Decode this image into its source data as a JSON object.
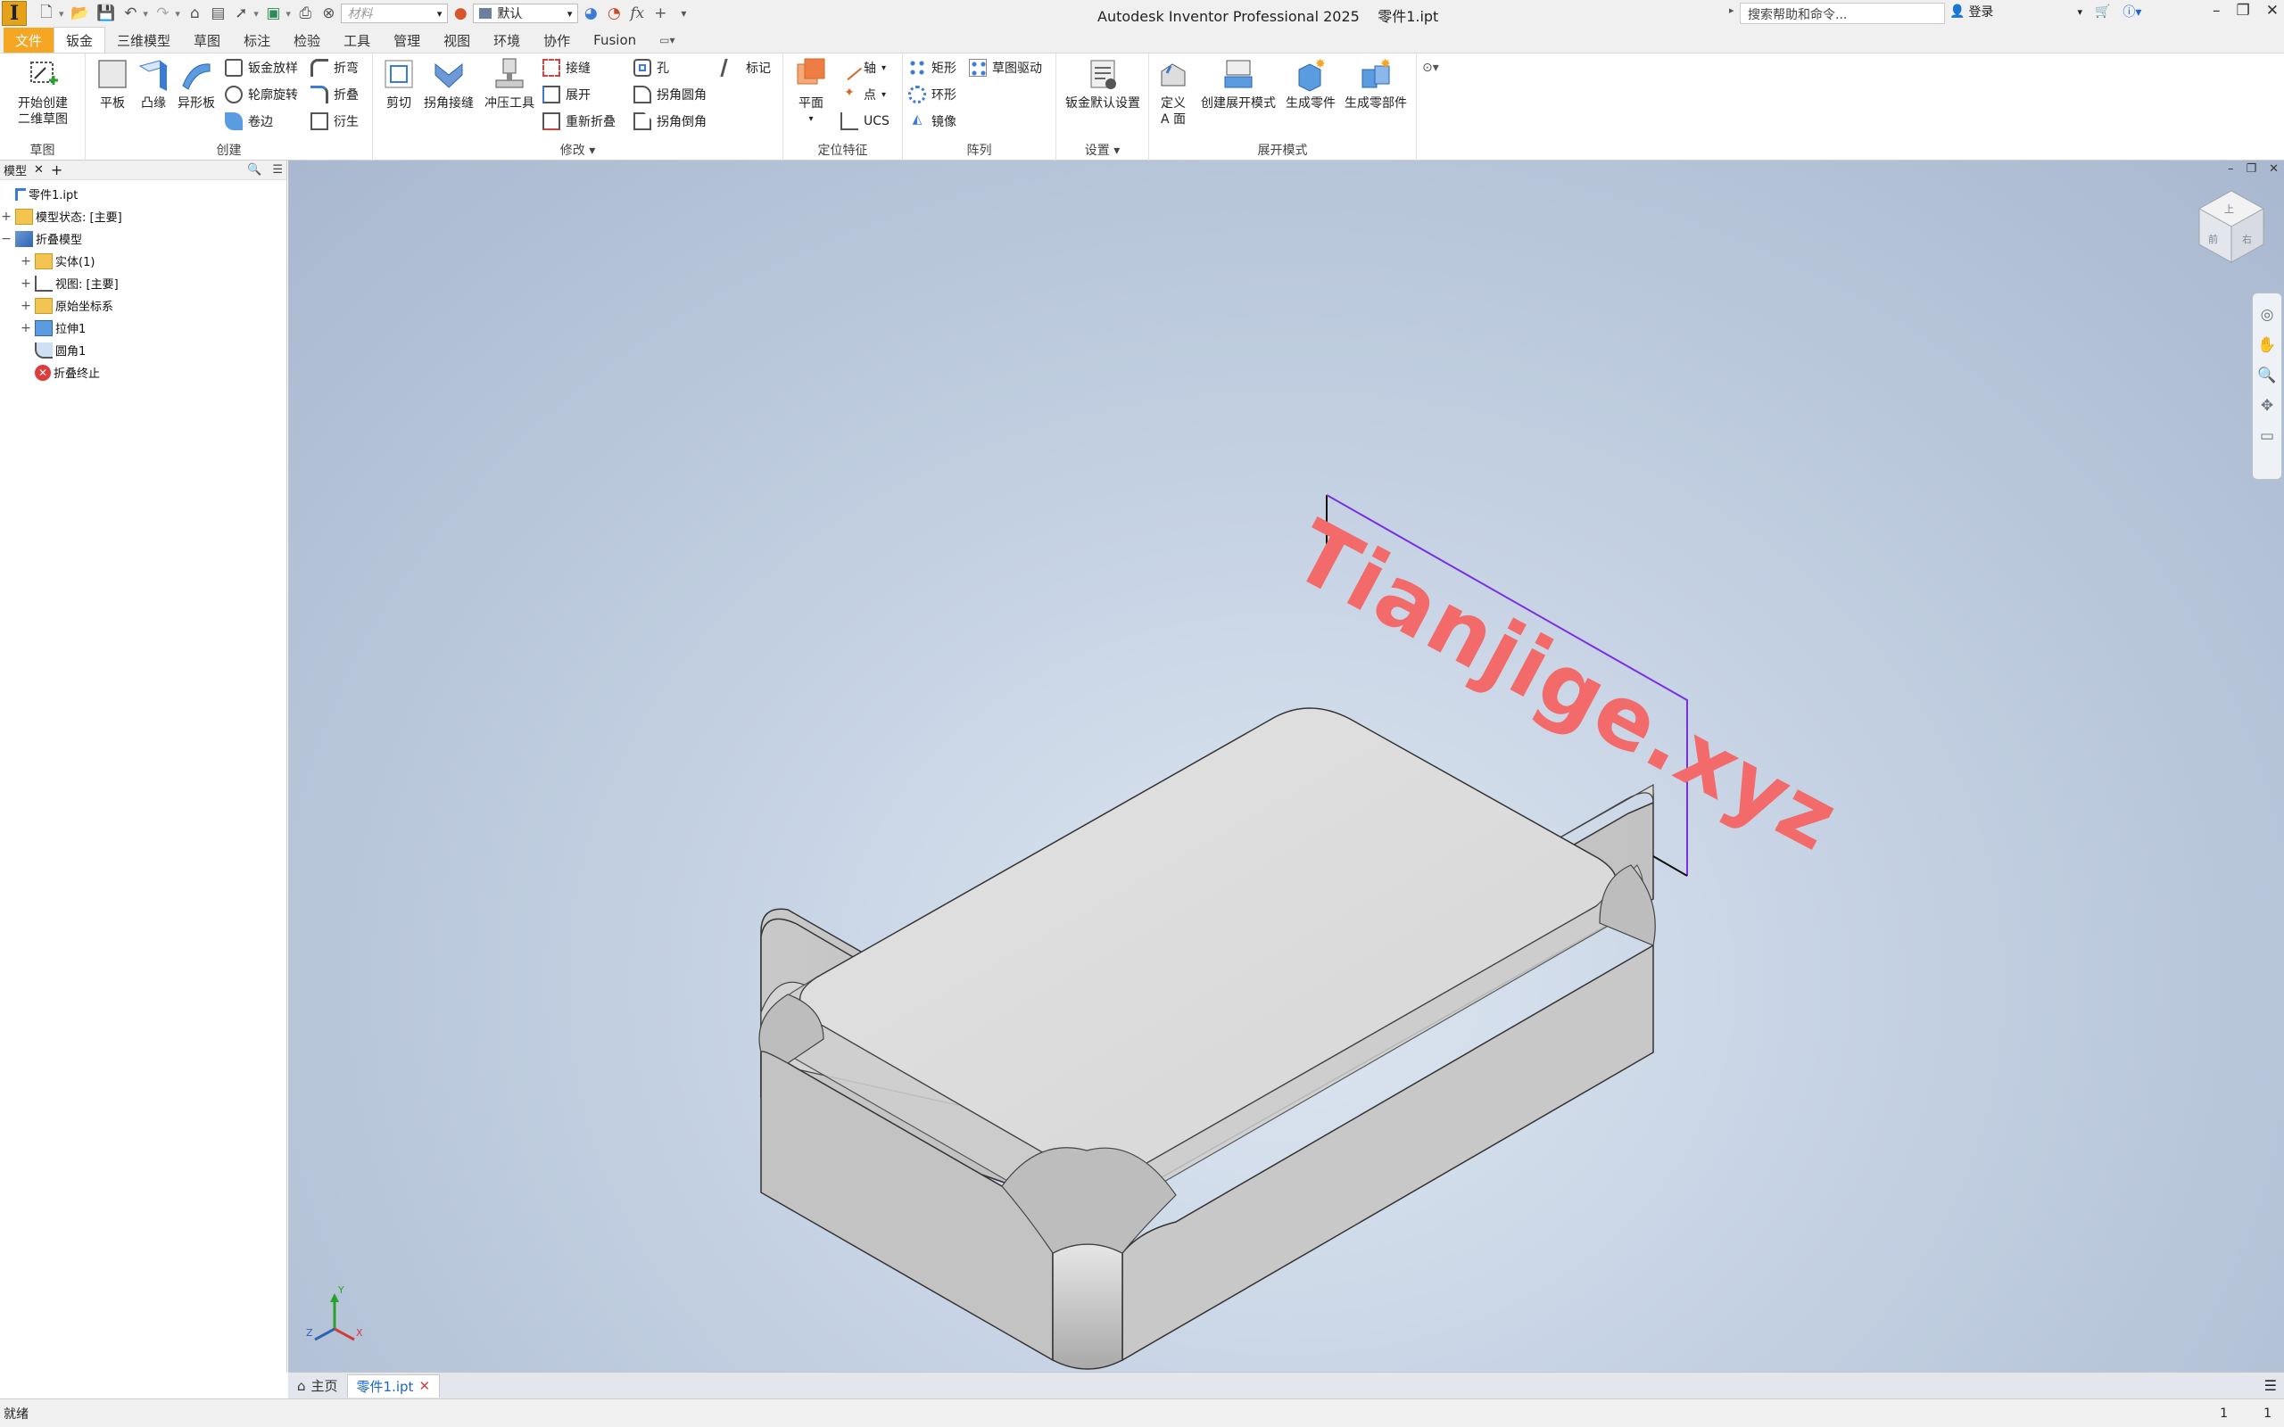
{
  "app": {
    "title": "Autodesk Inventor Professional 2025",
    "document": "零件1.ipt",
    "logo_letter": "I"
  },
  "quick_access": {
    "material_placeholder": "材料",
    "appearance_value": "默认",
    "fx_label": "fx"
  },
  "help": {
    "search_placeholder": "搜索帮助和命令...",
    "login": "登录"
  },
  "menu_tabs": [
    "文件",
    "钣金",
    "三维模型",
    "草图",
    "标注",
    "检验",
    "工具",
    "管理",
    "视图",
    "环境",
    "协作",
    "Fusion"
  ],
  "ribbon": {
    "sketch_panel": {
      "label": "草图",
      "start_sketch": "开始创建\n二维草图"
    },
    "create_panel": {
      "label": "创建",
      "face": "平板",
      "contour_flange": "凸缘",
      "lofted_flange": "异形板",
      "sm_loft": "钣金放样",
      "contour_roll": "轮廓旋转",
      "hem": "卷边",
      "bend": "折弯",
      "fold": "折叠",
      "derive": "衍生"
    },
    "modify_panel": {
      "label": "修改",
      "cut": "剪切",
      "corner_seam": "拐角接缝",
      "punch": "冲压工具",
      "rip": "接缝",
      "unfold": "展开",
      "refold": "重新折叠",
      "hole": "孔",
      "corner_round": "拐角圆角",
      "corner_chamfer": "拐角倒角",
      "mark": "标记"
    },
    "work_features_panel": {
      "label": "定位特征",
      "plane": "平面",
      "axis": "轴",
      "point": "点",
      "ucs": "UCS"
    },
    "pattern_panel": {
      "label": "阵列",
      "rect": "矩形",
      "circular": "环形",
      "mirror": "镜像",
      "sketch_driven": "草图驱动"
    },
    "settings_panel": {
      "label": "设置",
      "defaults": "钣金默认设置"
    },
    "flat_pattern_panel": {
      "label": "展开模式",
      "define_a_side": "定义\nA 面",
      "create_flat": "创建展开模式",
      "gen_part": "生成零件",
      "gen_parts": "生成零部件"
    }
  },
  "browser": {
    "tab_label": "模型",
    "tree": [
      {
        "label": "零件1.ipt",
        "level": 0,
        "expander": ""
      },
      {
        "label": "模型状态: [主要]",
        "level": 0,
        "expander": "+"
      },
      {
        "label": "折叠模型",
        "level": 0,
        "expander": "−"
      },
      {
        "label": "实体(1)",
        "level": 1,
        "expander": "+"
      },
      {
        "label": "视图: [主要]",
        "level": 1,
        "expander": "+"
      },
      {
        "label": "原始坐标系",
        "level": 1,
        "expander": "+"
      },
      {
        "label": "拉伸1",
        "level": 1,
        "expander": "+"
      },
      {
        "label": "圆角1",
        "level": 1,
        "expander": ""
      },
      {
        "label": "折叠终止",
        "level": 1,
        "expander": ""
      }
    ]
  },
  "viewport": {
    "watermark": "Tianjige.xyz",
    "axes": {
      "x": "X",
      "y": "Y",
      "z": "Z"
    },
    "viewcube_labels": {
      "top": "上",
      "front": "前",
      "right": "右"
    }
  },
  "doc_tabs": {
    "home": "主页",
    "active": "零件1.ipt"
  },
  "status": {
    "text": "就绪",
    "count1": "1",
    "count2": "1"
  },
  "colors": {
    "accent_orange": "#f5a623",
    "sketch_line": "#7a2fe0",
    "watermark": "#f26a6a"
  }
}
